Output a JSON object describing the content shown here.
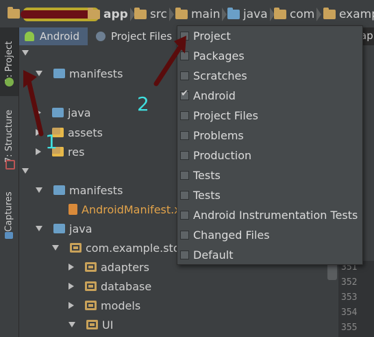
{
  "breadcrumbs": [
    {
      "label": "app"
    },
    {
      "label": "src"
    },
    {
      "label": "main"
    },
    {
      "label": "java"
    },
    {
      "label": "com"
    },
    {
      "label": "exampl"
    }
  ],
  "right_tab_fragment": "app",
  "sidebar": {
    "tabs": [
      {
        "label": "1: Project"
      },
      {
        "label": "7: Structure"
      },
      {
        "label": "Captures"
      }
    ]
  },
  "view_tabs": [
    {
      "label": "Android"
    },
    {
      "label": "Project Files"
    }
  ],
  "tree": [
    {
      "label": "",
      "expander": "down",
      "icon": "none",
      "level": 0
    },
    {
      "label": "manifests",
      "expander": "down",
      "icon": "folder-blue",
      "level": 1
    },
    {
      "label": "java",
      "expander": "right",
      "icon": "folder-blue",
      "level": 1
    },
    {
      "label": "assets",
      "expander": "right",
      "icon": "folder-res",
      "level": 1
    },
    {
      "label": "res",
      "expander": "right",
      "icon": "folder-res",
      "level": 1
    },
    {
      "label": "",
      "expander": "down",
      "icon": "none",
      "level": 0
    },
    {
      "label": "manifests",
      "expander": "down",
      "icon": "folder-blue",
      "level": 1
    },
    {
      "label": "AndroidManifest.x",
      "expander": "none",
      "icon": "manifest-file",
      "level": 2
    },
    {
      "label": "java",
      "expander": "down",
      "icon": "folder-blue",
      "level": 1
    },
    {
      "label": "com.example.stoc",
      "expander": "down",
      "icon": "package",
      "level": 2
    },
    {
      "label": "adapters",
      "expander": "right",
      "icon": "package",
      "level": 3
    },
    {
      "label": "database",
      "expander": "right",
      "icon": "package",
      "level": 3
    },
    {
      "label": "models",
      "expander": "right",
      "icon": "package",
      "level": 3
    },
    {
      "label": "UI",
      "expander": "down",
      "icon": "package",
      "level": 3
    }
  ],
  "view_menu": {
    "items": [
      {
        "label": "Project",
        "checked": false
      },
      {
        "label": "Packages",
        "checked": false
      },
      {
        "label": "Scratches",
        "checked": false
      },
      {
        "label": "Android",
        "checked": true
      },
      {
        "label": "Project Files",
        "checked": false
      },
      {
        "label": "Problems",
        "checked": false
      },
      {
        "label": "Production",
        "checked": false
      },
      {
        "label": "Tests",
        "checked": false
      },
      {
        "label": "Tests",
        "checked": false
      },
      {
        "label": "Android Instrumentation Tests",
        "checked": false
      },
      {
        "label": "Changed Files",
        "checked": false
      },
      {
        "label": "Default",
        "checked": false
      }
    ]
  },
  "line_numbers": [
    "351",
    "352",
    "353",
    "354",
    "355"
  ],
  "annotations": {
    "one": "1",
    "two": "2"
  },
  "colors": {
    "accent": "#4b5f78",
    "annotation_text": "#3fe0e0",
    "arrow": "#5a0c0c"
  }
}
